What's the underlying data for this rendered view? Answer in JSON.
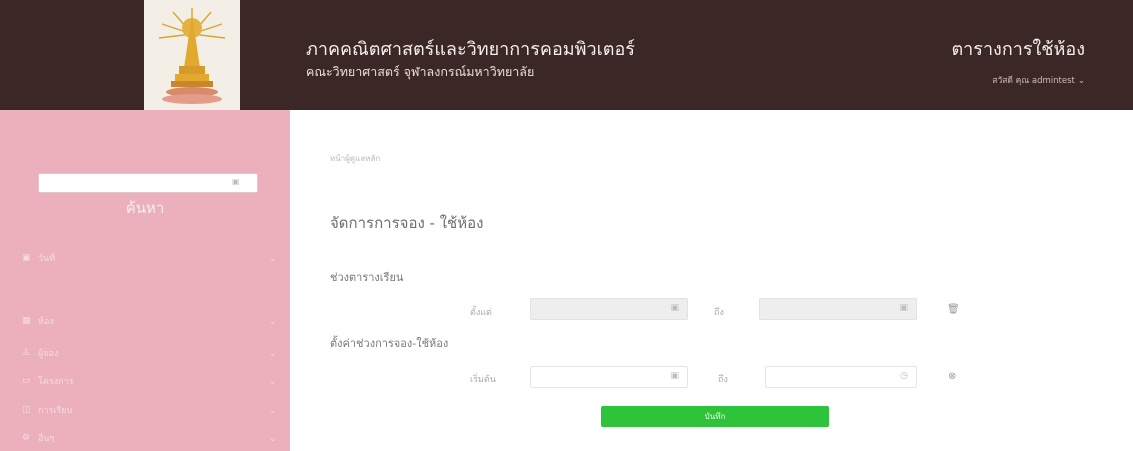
{
  "header": {
    "title": "ภาคคณิตศาสตร์และวิทยาการคอมพิวเตอร์",
    "subtitle": "คณะวิทยาศาสตร์ จุฬาลงกรณ์มหาวิทยาลัย",
    "app_name": "ตารางการใช้ห้อง",
    "greeting": "สวัสดี คุณ admintest",
    "colors": {
      "header_bg": "#3b2726",
      "sidebar_bg": "#ebb0bb",
      "submit_bg": "#2fc23b"
    }
  },
  "sidebar": {
    "heading": "ค้นหา",
    "date_filter": {
      "label": "วันที่",
      "icon": "calendar-icon"
    },
    "date_input": {
      "placeholder": "",
      "icon": "calendar-icon"
    },
    "items": [
      {
        "label": "ห้อง",
        "icon": "grid-icon"
      },
      {
        "label": "ผู้จอง",
        "icon": "user-icon"
      },
      {
        "label": "โครงการ",
        "icon": "folder-icon"
      },
      {
        "label": "การเรียน",
        "icon": "book-icon"
      },
      {
        "label": "อื่นๆ",
        "icon": "gear-icon"
      }
    ]
  },
  "main": {
    "breadcrumb": "หน้าผู้ดูแลหลัก",
    "page_title": "จัดการการจอง - ใช้ห้อง",
    "section_schedule": {
      "title": "ช่วงตารางเรียน",
      "start_label": "ตั้งแต่",
      "end_label": "ถึง",
      "start_value": "",
      "end_value": "",
      "action_icon": "trash-icon"
    },
    "section_booking": {
      "title": "ตั้งค่าช่วงการจอง-ใช้ห้อง",
      "start_label": "เริ่มต้น",
      "end_label": "ถึง",
      "start_placeholder": "",
      "end_placeholder": "",
      "action_icon": "close-icon"
    },
    "submit_label": "บันทึก"
  }
}
